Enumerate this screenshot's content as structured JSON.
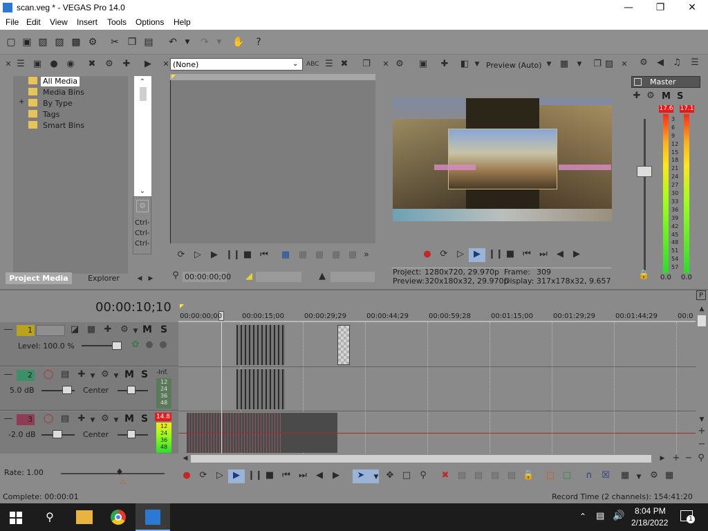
{
  "window": {
    "title": "scan.veg * - VEGAS Pro 14.0"
  },
  "menu": [
    "File",
    "Edit",
    "View",
    "Insert",
    "Tools",
    "Options",
    "Help"
  ],
  "project_media": {
    "tree": [
      "All Media",
      "Media Bins",
      "By Type",
      "Tags",
      "Smart Bins"
    ],
    "expand_marker": "+",
    "tabs": [
      "Project Media",
      "Explorer"
    ],
    "side_ctrls": [
      "Ctrl-",
      "Ctrl-",
      "Ctrl-"
    ],
    "sizer": "•:"
  },
  "trimmer": {
    "dropdown_value": "(None)",
    "timecode": "00:00:00;00"
  },
  "preview": {
    "quality": "Preview (Auto)",
    "project_label": "Project:",
    "project_value": "1280x720, 29.970p",
    "frame_label": "Frame:",
    "frame_value": "309",
    "preview_label": "Preview:",
    "preview_value": "320x180x32, 29.970p",
    "display_label": "Display:",
    "display_value": "317x178x32, 9.657"
  },
  "master": {
    "label": "Master",
    "m": "M",
    "s": "S",
    "peak_left": "17.6",
    "peak_right": "17.1",
    "scale": [
      "3",
      "6",
      "9",
      "12",
      "15",
      "18",
      "21",
      "24",
      "27",
      "30",
      "33",
      "36",
      "39",
      "42",
      "45",
      "48",
      "51",
      "54",
      "57"
    ],
    "bottom_left": "0.0",
    "bottom_right": "0.0"
  },
  "timeline": {
    "cursor_time": "00:00:10;10",
    "ruler": [
      "00:00:00;00",
      "00:00:15;00",
      "00:00:29;29",
      "00:00:44;29",
      "00:00:59;28",
      "00:01:15;00",
      "00:01:29;29",
      "00:01:44;29",
      "00:0"
    ],
    "tracks": [
      {
        "num": "1",
        "type": "video",
        "info": "Level: 100.0 %",
        "m": "M",
        "s": "S"
      },
      {
        "num": "2",
        "type": "audio",
        "info": "5.0 dB",
        "pan": "Center",
        "m": "M",
        "s": "S",
        "meter_top": "-Inf.",
        "meter_scale": [
          "12",
          "24",
          "36",
          "48"
        ]
      },
      {
        "num": "3",
        "type": "audio",
        "info": "-2.0 dB",
        "pan": "Center",
        "m": "M",
        "s": "S",
        "meter_top": "14.8",
        "meter_scale": [
          "12",
          "24",
          "36",
          "48"
        ]
      }
    ],
    "rate": "Rate: 1.00"
  },
  "status": {
    "left": "Complete: 00:00:01",
    "right": "Record Time (2 channels): 154:41:20"
  },
  "taskbar": {
    "time": "8:04 PM",
    "date": "2/18/2022",
    "notif_count": "1"
  },
  "colors": {
    "track1": "#b9a21d",
    "track2": "#3d8f67",
    "track3": "#8f3d57",
    "peak": "#e51a1a"
  }
}
